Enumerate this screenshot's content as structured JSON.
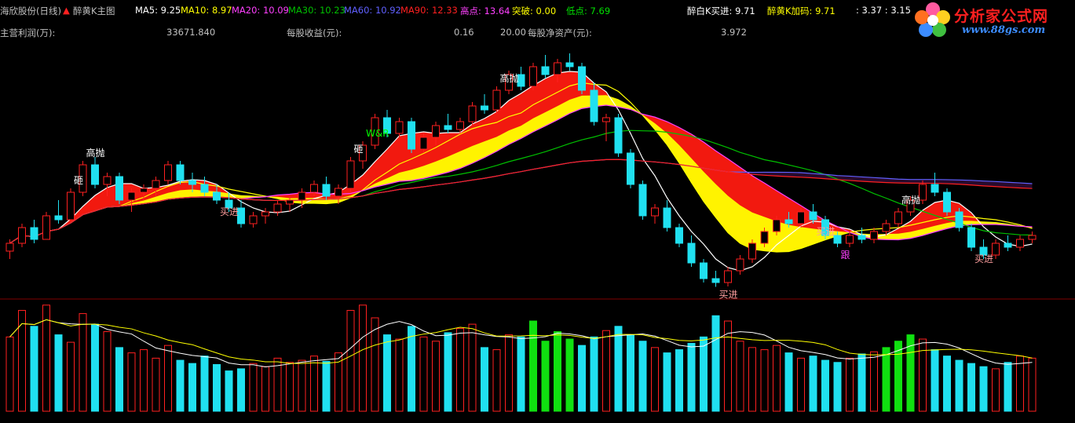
{
  "header": {
    "stock_name": "海欣股份(日线)",
    "indicator": "醉黄K主图",
    "ma5": "MA5: 9.25",
    "ma10": "MA10: 8.97",
    "ma20": "MA20: 10.09",
    "ma30": "MA30: 10.23",
    "ma60": "MA60: 10.92",
    "ma90": "MA90: 12.33",
    "high_point": "高点: 13.64",
    "breakout": "突破: 0.00",
    "low_point": "低点: 7.69",
    "white_k_buy": "醉白K买进: 9.71",
    "yellow_k": "醉黄K加码: 9.71",
    "extra": ": 3.37 : 3.15"
  },
  "info_row": {
    "profit_label": "主营利润(万):",
    "profit_value": "33671.840",
    "eps_label": "每股收益(元):",
    "eps_value": "0.16",
    "price_label": "20.00",
    "nav_label": "每股净资产(元):",
    "nav_value": "3.972"
  },
  "watermark": {
    "title": "分析家公式网",
    "url": "www.88gs.com"
  },
  "colors": {
    "up": "#ff2020",
    "down": "#20e0f0",
    "ma5": "#ffffff",
    "ma10": "#ffff00",
    "ma20": "#ff40ff",
    "ma30": "#00c000",
    "ma60": "#6060ff",
    "ma90": "#ff2020",
    "ribbon_red": "#ff1a10",
    "ribbon_yellow": "#ffff00",
    "vol_green": "#10e010"
  },
  "chart_data": {
    "type": "candlestick",
    "title": "海欣股份(日线)",
    "signals": [
      "高抛",
      "砸",
      "买进",
      "跟",
      "W&R"
    ],
    "candles": [
      [
        8.6,
        8.9,
        8.4,
        8.8
      ],
      [
        8.8,
        9.3,
        8.7,
        9.2
      ],
      [
        9.2,
        9.4,
        8.8,
        8.9
      ],
      [
        8.9,
        9.6,
        8.9,
        9.5
      ],
      [
        9.5,
        9.9,
        9.3,
        9.4
      ],
      [
        9.4,
        10.2,
        9.4,
        10.1
      ],
      [
        10.1,
        10.9,
        10.0,
        10.8
      ],
      [
        10.8,
        11.0,
        10.2,
        10.3
      ],
      [
        10.3,
        10.6,
        10.0,
        10.5
      ],
      [
        10.5,
        10.6,
        9.8,
        9.9
      ],
      [
        9.9,
        10.2,
        9.6,
        10.1
      ],
      [
        10.1,
        10.3,
        9.9,
        10.2
      ],
      [
        10.2,
        10.5,
        10.0,
        10.4
      ],
      [
        10.4,
        10.9,
        10.3,
        10.8
      ],
      [
        10.8,
        10.9,
        10.3,
        10.4
      ],
      [
        10.4,
        10.6,
        10.1,
        10.3
      ],
      [
        10.3,
        10.5,
        10.0,
        10.1
      ],
      [
        10.1,
        10.3,
        9.8,
        9.9
      ],
      [
        9.9,
        10.1,
        9.6,
        9.7
      ],
      [
        9.7,
        9.9,
        9.2,
        9.3
      ],
      [
        9.3,
        9.6,
        9.2,
        9.5
      ],
      [
        9.5,
        9.7,
        9.3,
        9.6
      ],
      [
        9.6,
        9.9,
        9.5,
        9.8
      ],
      [
        9.8,
        10.0,
        9.6,
        9.9
      ],
      [
        9.9,
        10.2,
        9.7,
        10.1
      ],
      [
        10.1,
        10.4,
        10.0,
        10.3
      ],
      [
        10.3,
        10.5,
        9.9,
        10.0
      ],
      [
        10.0,
        10.3,
        9.8,
        10.2
      ],
      [
        10.2,
        11.0,
        10.1,
        10.9
      ],
      [
        10.9,
        11.4,
        10.7,
        11.3
      ],
      [
        11.3,
        12.1,
        11.2,
        12.0
      ],
      [
        12.0,
        12.2,
        11.5,
        11.6
      ],
      [
        11.6,
        12.0,
        11.5,
        11.9
      ],
      [
        11.9,
        12.0,
        11.1,
        11.2
      ],
      [
        11.2,
        11.6,
        11.1,
        11.5
      ],
      [
        11.5,
        11.9,
        11.3,
        11.8
      ],
      [
        11.8,
        12.1,
        11.6,
        11.7
      ],
      [
        11.7,
        12.0,
        11.6,
        11.9
      ],
      [
        11.9,
        12.4,
        11.8,
        12.3
      ],
      [
        12.3,
        12.6,
        12.1,
        12.2
      ],
      [
        12.2,
        12.8,
        12.1,
        12.7
      ],
      [
        12.7,
        13.2,
        12.6,
        13.1
      ],
      [
        13.1,
        13.3,
        12.7,
        12.8
      ],
      [
        12.8,
        13.4,
        12.7,
        13.3
      ],
      [
        13.3,
        13.6,
        13.0,
        13.1
      ],
      [
        13.1,
        13.5,
        12.9,
        13.4
      ],
      [
        13.4,
        13.64,
        13.2,
        13.3
      ],
      [
        13.3,
        13.4,
        12.6,
        12.7
      ],
      [
        12.7,
        12.9,
        11.8,
        11.9
      ],
      [
        11.9,
        12.1,
        11.4,
        12.0
      ],
      [
        12.0,
        12.1,
        11.0,
        11.1
      ],
      [
        11.1,
        11.2,
        10.2,
        10.3
      ],
      [
        10.3,
        10.4,
        9.4,
        9.5
      ],
      [
        9.5,
        9.8,
        9.3,
        9.7
      ],
      [
        9.7,
        9.9,
        9.1,
        9.2
      ],
      [
        9.2,
        9.3,
        8.7,
        8.8
      ],
      [
        8.8,
        9.0,
        8.2,
        8.3
      ],
      [
        8.3,
        8.4,
        7.8,
        7.9
      ],
      [
        7.9,
        8.1,
        7.69,
        7.8
      ],
      [
        7.8,
        8.2,
        7.7,
        8.1
      ],
      [
        8.1,
        8.5,
        8.0,
        8.4
      ],
      [
        8.4,
        8.9,
        8.3,
        8.8
      ],
      [
        8.8,
        9.2,
        8.7,
        9.1
      ],
      [
        9.1,
        9.5,
        9.0,
        9.4
      ],
      [
        9.4,
        9.6,
        9.2,
        9.3
      ],
      [
        9.3,
        9.7,
        9.2,
        9.6
      ],
      [
        9.6,
        9.8,
        9.3,
        9.4
      ],
      [
        9.4,
        9.5,
        8.9,
        9.0
      ],
      [
        9.0,
        9.1,
        8.7,
        8.8
      ],
      [
        8.8,
        9.1,
        8.7,
        9.0
      ],
      [
        9.0,
        9.2,
        8.8,
        8.9
      ],
      [
        8.9,
        9.2,
        8.8,
        9.1
      ],
      [
        9.1,
        9.4,
        9.0,
        9.3
      ],
      [
        9.3,
        9.7,
        9.2,
        9.6
      ],
      [
        9.6,
        10.0,
        9.5,
        9.9
      ],
      [
        9.9,
        10.4,
        9.8,
        10.3
      ],
      [
        10.3,
        10.6,
        10.0,
        10.1
      ],
      [
        10.1,
        10.2,
        9.5,
        9.6
      ],
      [
        9.6,
        9.7,
        9.1,
        9.2
      ],
      [
        9.2,
        9.3,
        8.6,
        8.7
      ],
      [
        8.7,
        8.9,
        8.4,
        8.5
      ],
      [
        8.5,
        8.9,
        8.4,
        8.8
      ],
      [
        8.8,
        9.0,
        8.6,
        8.7
      ],
      [
        8.7,
        9.0,
        8.6,
        8.9
      ],
      [
        8.9,
        9.1,
        8.8,
        9.0
      ]
    ],
    "volume": [
      70,
      95,
      80,
      100,
      72,
      65,
      92,
      82,
      75,
      60,
      55,
      58,
      50,
      62,
      48,
      45,
      52,
      44,
      38,
      40,
      45,
      42,
      50,
      46,
      48,
      52,
      47,
      55,
      95,
      100,
      88,
      72,
      68,
      80,
      70,
      66,
      74,
      78,
      82,
      60,
      58,
      72,
      70,
      85,
      66,
      75,
      68,
      62,
      70,
      76,
      80,
      72,
      66,
      60,
      55,
      58,
      64,
      70,
      90,
      85,
      66,
      60,
      58,
      62,
      55,
      50,
      52,
      48,
      46,
      50,
      54,
      56,
      60,
      66,
      72,
      68,
      58,
      52,
      48,
      45,
      42,
      40,
      46,
      52,
      50
    ]
  }
}
